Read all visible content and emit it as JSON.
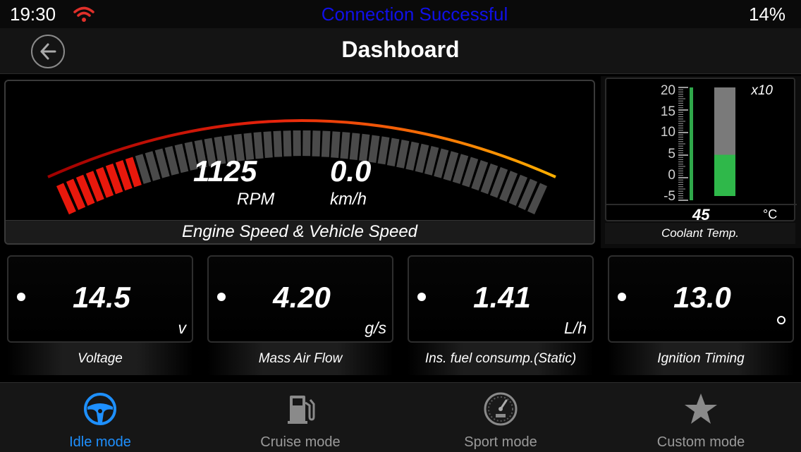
{
  "status_bar": {
    "time": "19:30",
    "connection": "Connection Successful",
    "battery": "14%",
    "wifi_color": "#e0302a",
    "connection_color": "#1010e8"
  },
  "nav": {
    "title": "Dashboard",
    "back_icon": "back-arrow-icon"
  },
  "engine_gauge": {
    "rpm_value": "1125",
    "rpm_unit": "RPM",
    "speed_value": "0.0",
    "speed_unit": "km/h",
    "caption": "Engine Speed & Vehicle Speed",
    "rpm_fill_fraction": 0.15,
    "lit_color": "#e8180c"
  },
  "coolant": {
    "scale_labels": [
      "20",
      "15",
      "10",
      "5",
      "0",
      "-5"
    ],
    "multiplier": "x10",
    "value": "45",
    "unit": "°C",
    "caption": "Coolant Temp.",
    "level_fraction": 0.38,
    "fill_color": "#2fb84a"
  },
  "cards": [
    {
      "value": "14.5",
      "unit": "v",
      "caption": "Voltage"
    },
    {
      "value": "4.20",
      "unit": "g/s",
      "caption": "Mass Air Flow"
    },
    {
      "value": "1.41",
      "unit": "L/h",
      "caption": "Ins. fuel consump.(Static)"
    },
    {
      "value": "13.0",
      "unit": "°",
      "caption": "Ignition Timing"
    }
  ],
  "tabs": [
    {
      "label": "Idle mode",
      "icon": "steering-wheel-icon",
      "active": true
    },
    {
      "label": "Cruise mode",
      "icon": "fuel-pump-icon",
      "active": false
    },
    {
      "label": "Sport mode",
      "icon": "speedometer-icon",
      "active": false
    },
    {
      "label": "Custom mode",
      "icon": "star-icon",
      "active": false
    }
  ],
  "accent_color": "#1e90ff"
}
